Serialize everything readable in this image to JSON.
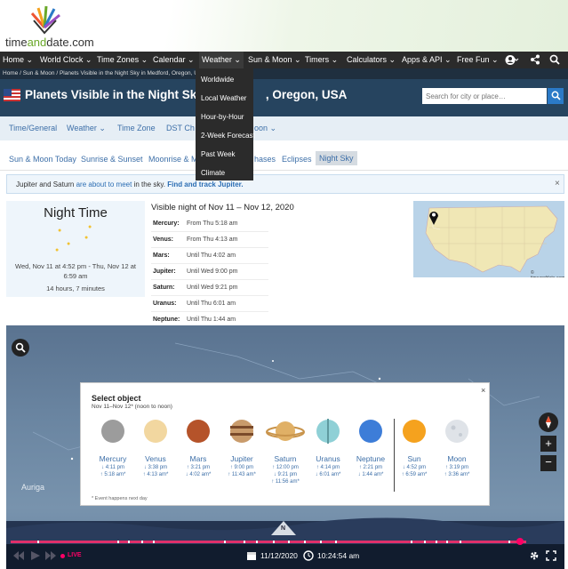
{
  "logo": {
    "brand_a": "time",
    "brand_b": "and",
    "brand_c": "date",
    "brand_d": ".com"
  },
  "nav": {
    "items": [
      "Home ⌄",
      "World Clock ⌄",
      "Time Zones ⌄",
      "Calendar ⌄",
      "Weather ⌄",
      "Sun & Moon ⌄",
      "Timers ⌄",
      "Calculators ⌄",
      "Apps & API ⌄",
      "Free Fun ⌄"
    ],
    "icons": [
      "user-icon",
      "share-icon",
      "search-icon"
    ]
  },
  "weather_menu": [
    "Worldwide",
    "Local Weather",
    "Hour-by-Hour",
    "2-Week Forecast",
    "Past Week",
    "Climate"
  ],
  "breadcrumb": {
    "a": "Home",
    "b": "Sun & Moon",
    "c": "Planets Visible in the Night Sky in Medford, Oregon, USA"
  },
  "page": {
    "title_left": "Planets Visible in the Night Sky",
    "title_right": ", Oregon, USA",
    "search_placeholder": "Search for city or place…"
  },
  "tabs_primary": [
    "Time/General",
    "Weather ⌄",
    "Time Zone",
    "DST Ch",
    "oon ⌄"
  ],
  "tabs_secondary": [
    "Sun & Moon Today",
    "Sunrise & Sunset",
    "Moonrise & M",
    "hases",
    "Eclipses",
    "Night Sky"
  ],
  "notice": {
    "text_a": "Jupiter and Saturn ",
    "text_b": "are about to meet",
    "text_c": " in the sky. ",
    "link": "Find and track Jupiter.",
    "close": "×"
  },
  "night_time": {
    "title": "Night Time",
    "date_a": "Wed, Nov 11 at 4:52 pm - Thu, Nov 12 at",
    "date_b": "6:59 am",
    "duration": "14 hours, 7 minutes"
  },
  "visible": {
    "title": "Visible night of Nov 11 – Nov 12, 2020",
    "planets": [
      {
        "name": "Mercury:",
        "value": "From Thu 5:18 am"
      },
      {
        "name": "Venus:",
        "value": "From Thu 4:13 am"
      },
      {
        "name": "Mars:",
        "value": "Until Thu 4:02 am"
      },
      {
        "name": "Jupiter:",
        "value": "Until Wed 9:00 pm"
      },
      {
        "name": "Saturn:",
        "value": "Until Wed 9:21 pm"
      },
      {
        "name": "Uranus:",
        "value": "Until Thu 6:01 am"
      },
      {
        "name": "Neptune:",
        "value": "Until Thu 1:44 am"
      }
    ]
  },
  "map": {
    "credit": "© timeanddate.com"
  },
  "sky": {
    "label_auriga": "Auriga",
    "compass": "N",
    "live": "LIVE",
    "date": "11/12/2020",
    "time": "10:24:54 am"
  },
  "select_object": {
    "title": "Select object",
    "sub": "Nov 11–Nov 12* (noon to noon)",
    "close": "×",
    "note": "* Event happens next day",
    "objects": [
      {
        "name": "Mercury",
        "t1": "↓ 4:11 pm",
        "t2": "↑ 5:18 am*",
        "t3": "",
        "color": "#9c9c9c"
      },
      {
        "name": "Venus",
        "t1": "↓ 3:38 pm",
        "t2": "↑ 4:13 am*",
        "t3": "",
        "color": "#f2d7a0"
      },
      {
        "name": "Mars",
        "t1": "↑ 3:21 pm",
        "t2": "↓ 4:02 am*",
        "t3": "",
        "color": "#b5532a"
      },
      {
        "name": "Jupiter",
        "t1": "↑ 9:00 pm",
        "t2": "↑ 11:43 am*",
        "t3": "",
        "color": "#c99b6b"
      },
      {
        "name": "Saturn",
        "t1": "↑ 12:00 pm",
        "t2": "↓ 9:21 pm",
        "t3": "↑ 11:56 am*",
        "color": "#e0b066"
      },
      {
        "name": "Uranus",
        "t1": "↑ 4:14 pm",
        "t2": "↓ 6:01 am*",
        "t3": "",
        "color": "#8fd0d6"
      },
      {
        "name": "Neptune",
        "t1": "↑ 2:21 pm",
        "t2": "↓ 1:44 am*",
        "t3": "",
        "color": "#3d7dd8"
      },
      {
        "name": "Sun",
        "t1": "↓ 4:52 pm",
        "t2": "↑ 6:59 am*",
        "t3": "",
        "color": "#f5a21e"
      },
      {
        "name": "Moon",
        "t1": "↑ 3:19 pm",
        "t2": "↑ 3:36 am*",
        "t3": "",
        "color": "#dfe3e8"
      }
    ]
  }
}
